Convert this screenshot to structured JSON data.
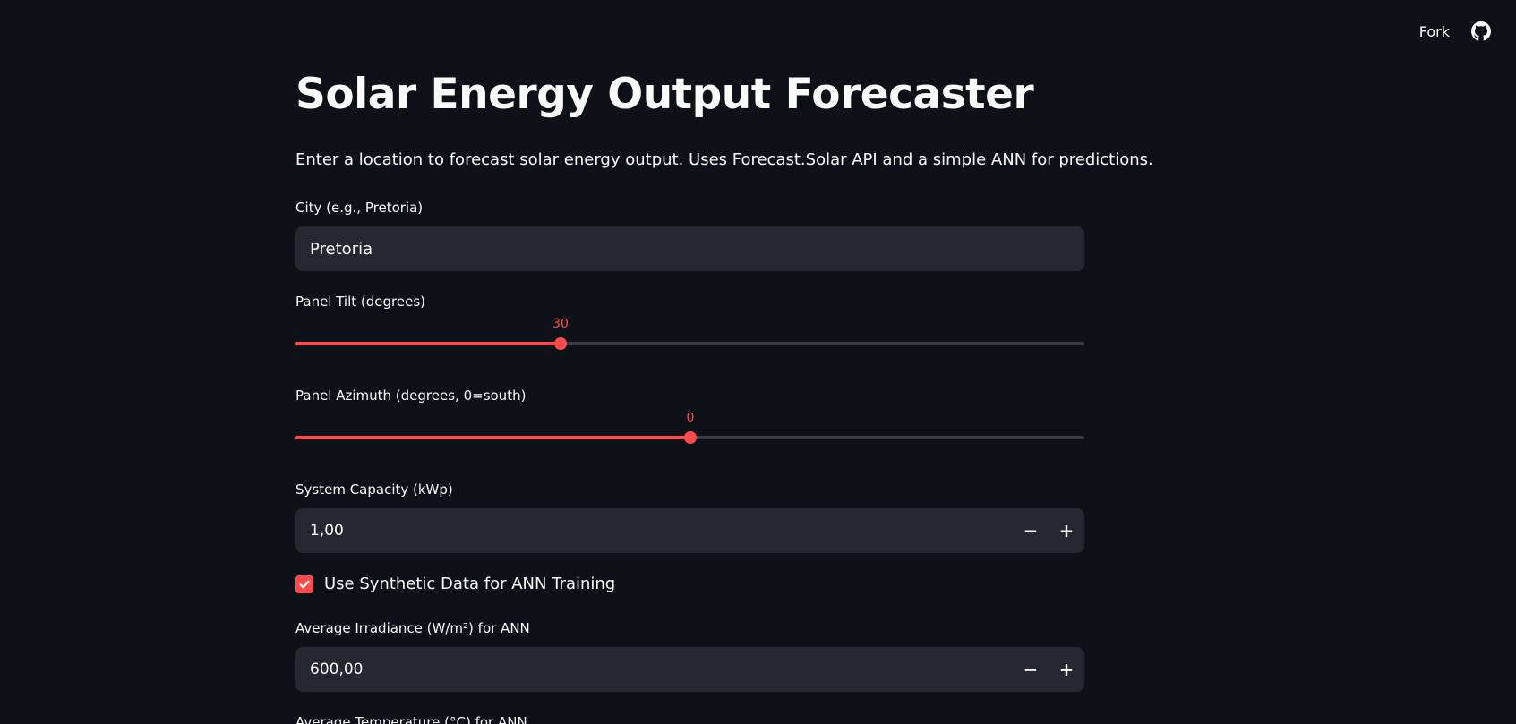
{
  "header": {
    "fork_label": "Fork",
    "github_icon": "github-icon"
  },
  "main": {
    "title": "Solar Energy Output Forecaster",
    "description": "Enter a location to forecast solar energy output. Uses Forecast.Solar API and a simple ANN for predictions.",
    "city": {
      "label": "City (e.g., Pretoria)",
      "value": "Pretoria"
    },
    "tilt": {
      "label": "Panel Tilt (degrees)",
      "value": "30",
      "fraction": 0.336
    },
    "azimuth": {
      "label": "Panel Azimuth (degrees, 0=south)",
      "value": "0",
      "fraction": 0.5
    },
    "capacity": {
      "label": "System Capacity (kWp)",
      "value": "1,00",
      "minus": "−",
      "plus": "+"
    },
    "synthetic": {
      "label": "Use Synthetic Data for ANN Training",
      "checked": true
    },
    "irradiance": {
      "label": "Average Irradiance (W/m²) for ANN",
      "value": "600,00",
      "minus": "−",
      "plus": "+"
    },
    "temperature": {
      "label": "Average Temperature (°C) for ANN"
    }
  },
  "colors": {
    "background": "#0e1117",
    "accent": "#ff4b4b",
    "input_bg": "#262730"
  }
}
